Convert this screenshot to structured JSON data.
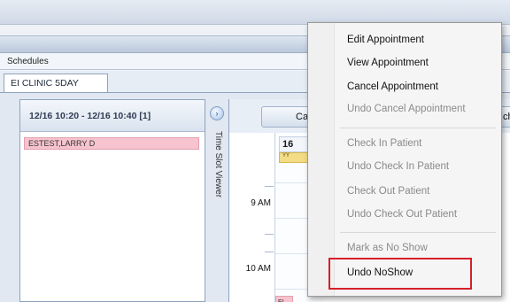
{
  "window": {
    "section_label": "Schedules"
  },
  "tab": {
    "label": "EI CLINIC 5DAY"
  },
  "time_slot": {
    "range": "12/16 10:20 - 12/16 10:40  [1]",
    "patient": "ESTEST,LARRY D",
    "viewer_label": "Time Slot Viewer",
    "expand_glyph": "›"
  },
  "calendar": {
    "button_label": "Ca",
    "button2_label": "ch",
    "day_header": "16",
    "yellow_label": "YY",
    "hours": [
      "9 AM",
      "10 AM"
    ],
    "appt_label": "EL"
  },
  "context_menu": {
    "items": [
      {
        "label": "Edit Appointment",
        "enabled": true
      },
      {
        "label": "View Appointment",
        "enabled": true
      },
      {
        "label": "Cancel Appointment",
        "enabled": true
      },
      {
        "label": "Undo Cancel Appointment",
        "enabled": false
      },
      {
        "label": "Check In Patient",
        "enabled": false
      },
      {
        "label": "Undo Check In Patient",
        "enabled": false
      },
      {
        "label": "Check Out Patient",
        "enabled": false
      },
      {
        "label": "Undo Check Out Patient",
        "enabled": false
      },
      {
        "label": "Mark as No Show",
        "enabled": false
      },
      {
        "label": "Undo NoShow",
        "enabled": true
      }
    ]
  },
  "colors": {
    "highlight_border": "#d61f2a",
    "patient_fill": "#f6c3ce",
    "accent_blue": "#8ea3bf"
  }
}
